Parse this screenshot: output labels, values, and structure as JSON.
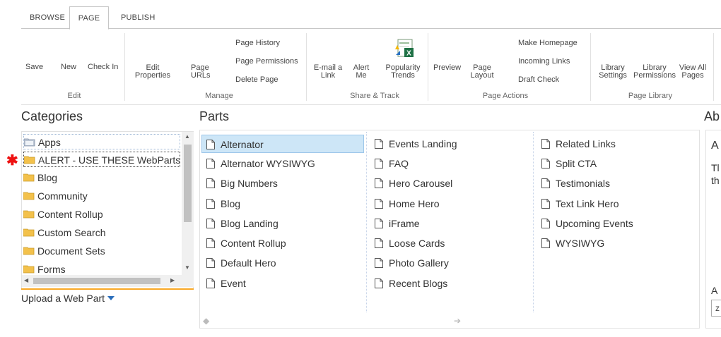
{
  "ribbon": {
    "tabs": [
      {
        "label": "BROWSE",
        "active": false
      },
      {
        "label": "PAGE",
        "active": true
      },
      {
        "label": "PUBLISH",
        "active": false
      }
    ],
    "edit_group": {
      "label": "Edit",
      "save": "Save",
      "new": "New",
      "check_in": "Check In"
    },
    "manage_group": {
      "label": "Manage",
      "edit_properties_1": "Edit",
      "edit_properties_2": "Properties",
      "page_urls_1": "Page",
      "page_urls_2": "URLs",
      "page_history": "Page History",
      "page_permissions": "Page Permissions",
      "delete_page": "Delete Page"
    },
    "share_group": {
      "label": "Share & Track",
      "email_1": "E-mail a",
      "email_2": "Link",
      "alert_1": "Alert",
      "alert_2": "Me",
      "popularity_1": "Popularity",
      "popularity_2": "Trends"
    },
    "page_actions_group": {
      "label": "Page Actions",
      "preview": "Preview",
      "page_layout_1": "Page",
      "page_layout_2": "Layout",
      "make_homepage": "Make Homepage",
      "incoming_links": "Incoming Links",
      "draft_check": "Draft Check"
    },
    "library_group": {
      "label": "Page Library",
      "library_settings_1": "Library",
      "library_settings_2": "Settings",
      "library_permissions_1": "Library",
      "library_permissions_2": "Permissions",
      "view_all_1": "View All",
      "view_all_2": "Pages"
    }
  },
  "categories": {
    "heading": "Categories",
    "items": [
      "Apps",
      "ALERT - USE THESE WebParts",
      "Blog",
      "Community",
      "Content Rollup",
      "Custom Search",
      "Document Sets",
      "Forms"
    ],
    "selected": "ALERT - USE THESE WebParts",
    "upload_label": "Upload a Web Part"
  },
  "parts": {
    "heading": "Parts",
    "column1": [
      "Alternator",
      "Alternator WYSIWYG",
      "Big Numbers",
      "Blog",
      "Blog Landing",
      "Content Rollup",
      "Default Hero",
      "Event"
    ],
    "column2": [
      "Events Landing",
      "FAQ",
      "Hero Carousel",
      "Home Hero",
      "iFrame",
      "Loose Cards",
      "Photo Gallery",
      "Recent Blogs"
    ],
    "column3": [
      "Related Links",
      "Split CTA",
      "Testimonials",
      "Text Link Hero",
      "Upcoming Events",
      "WYSIWYG"
    ],
    "selected": "Alternator"
  },
  "about": {
    "heading": "Ab",
    "title_fragment": "A",
    "line1": "Tl",
    "line2": "th",
    "label_fragment": "A",
    "input_fragment": "z"
  },
  "colors": {
    "accent_orange": "#f9a825",
    "selection_blue": "#cde6f7",
    "alert_red": "#ee1111"
  }
}
